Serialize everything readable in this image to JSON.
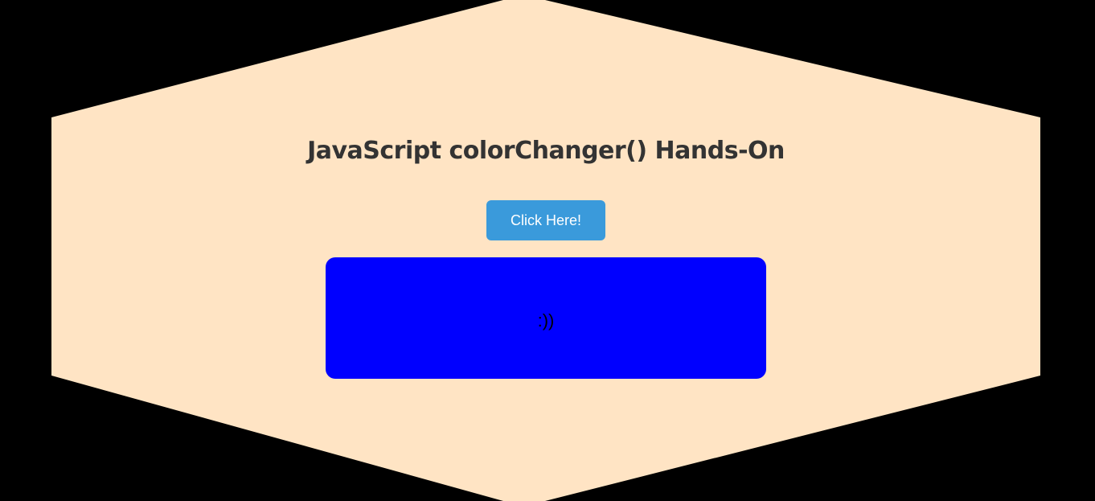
{
  "page": {
    "title": "JavaScript colorChanger() Hands-On"
  },
  "button": {
    "label": "Click Here!"
  },
  "box": {
    "text": ":))"
  },
  "colors": {
    "background": "#000000",
    "hexagon": "#FFE4C4",
    "title": "#333333",
    "button": "#3A9ADB",
    "button_text": "#FFFFFF",
    "box": "#0000FF",
    "box_text": "#000000"
  }
}
